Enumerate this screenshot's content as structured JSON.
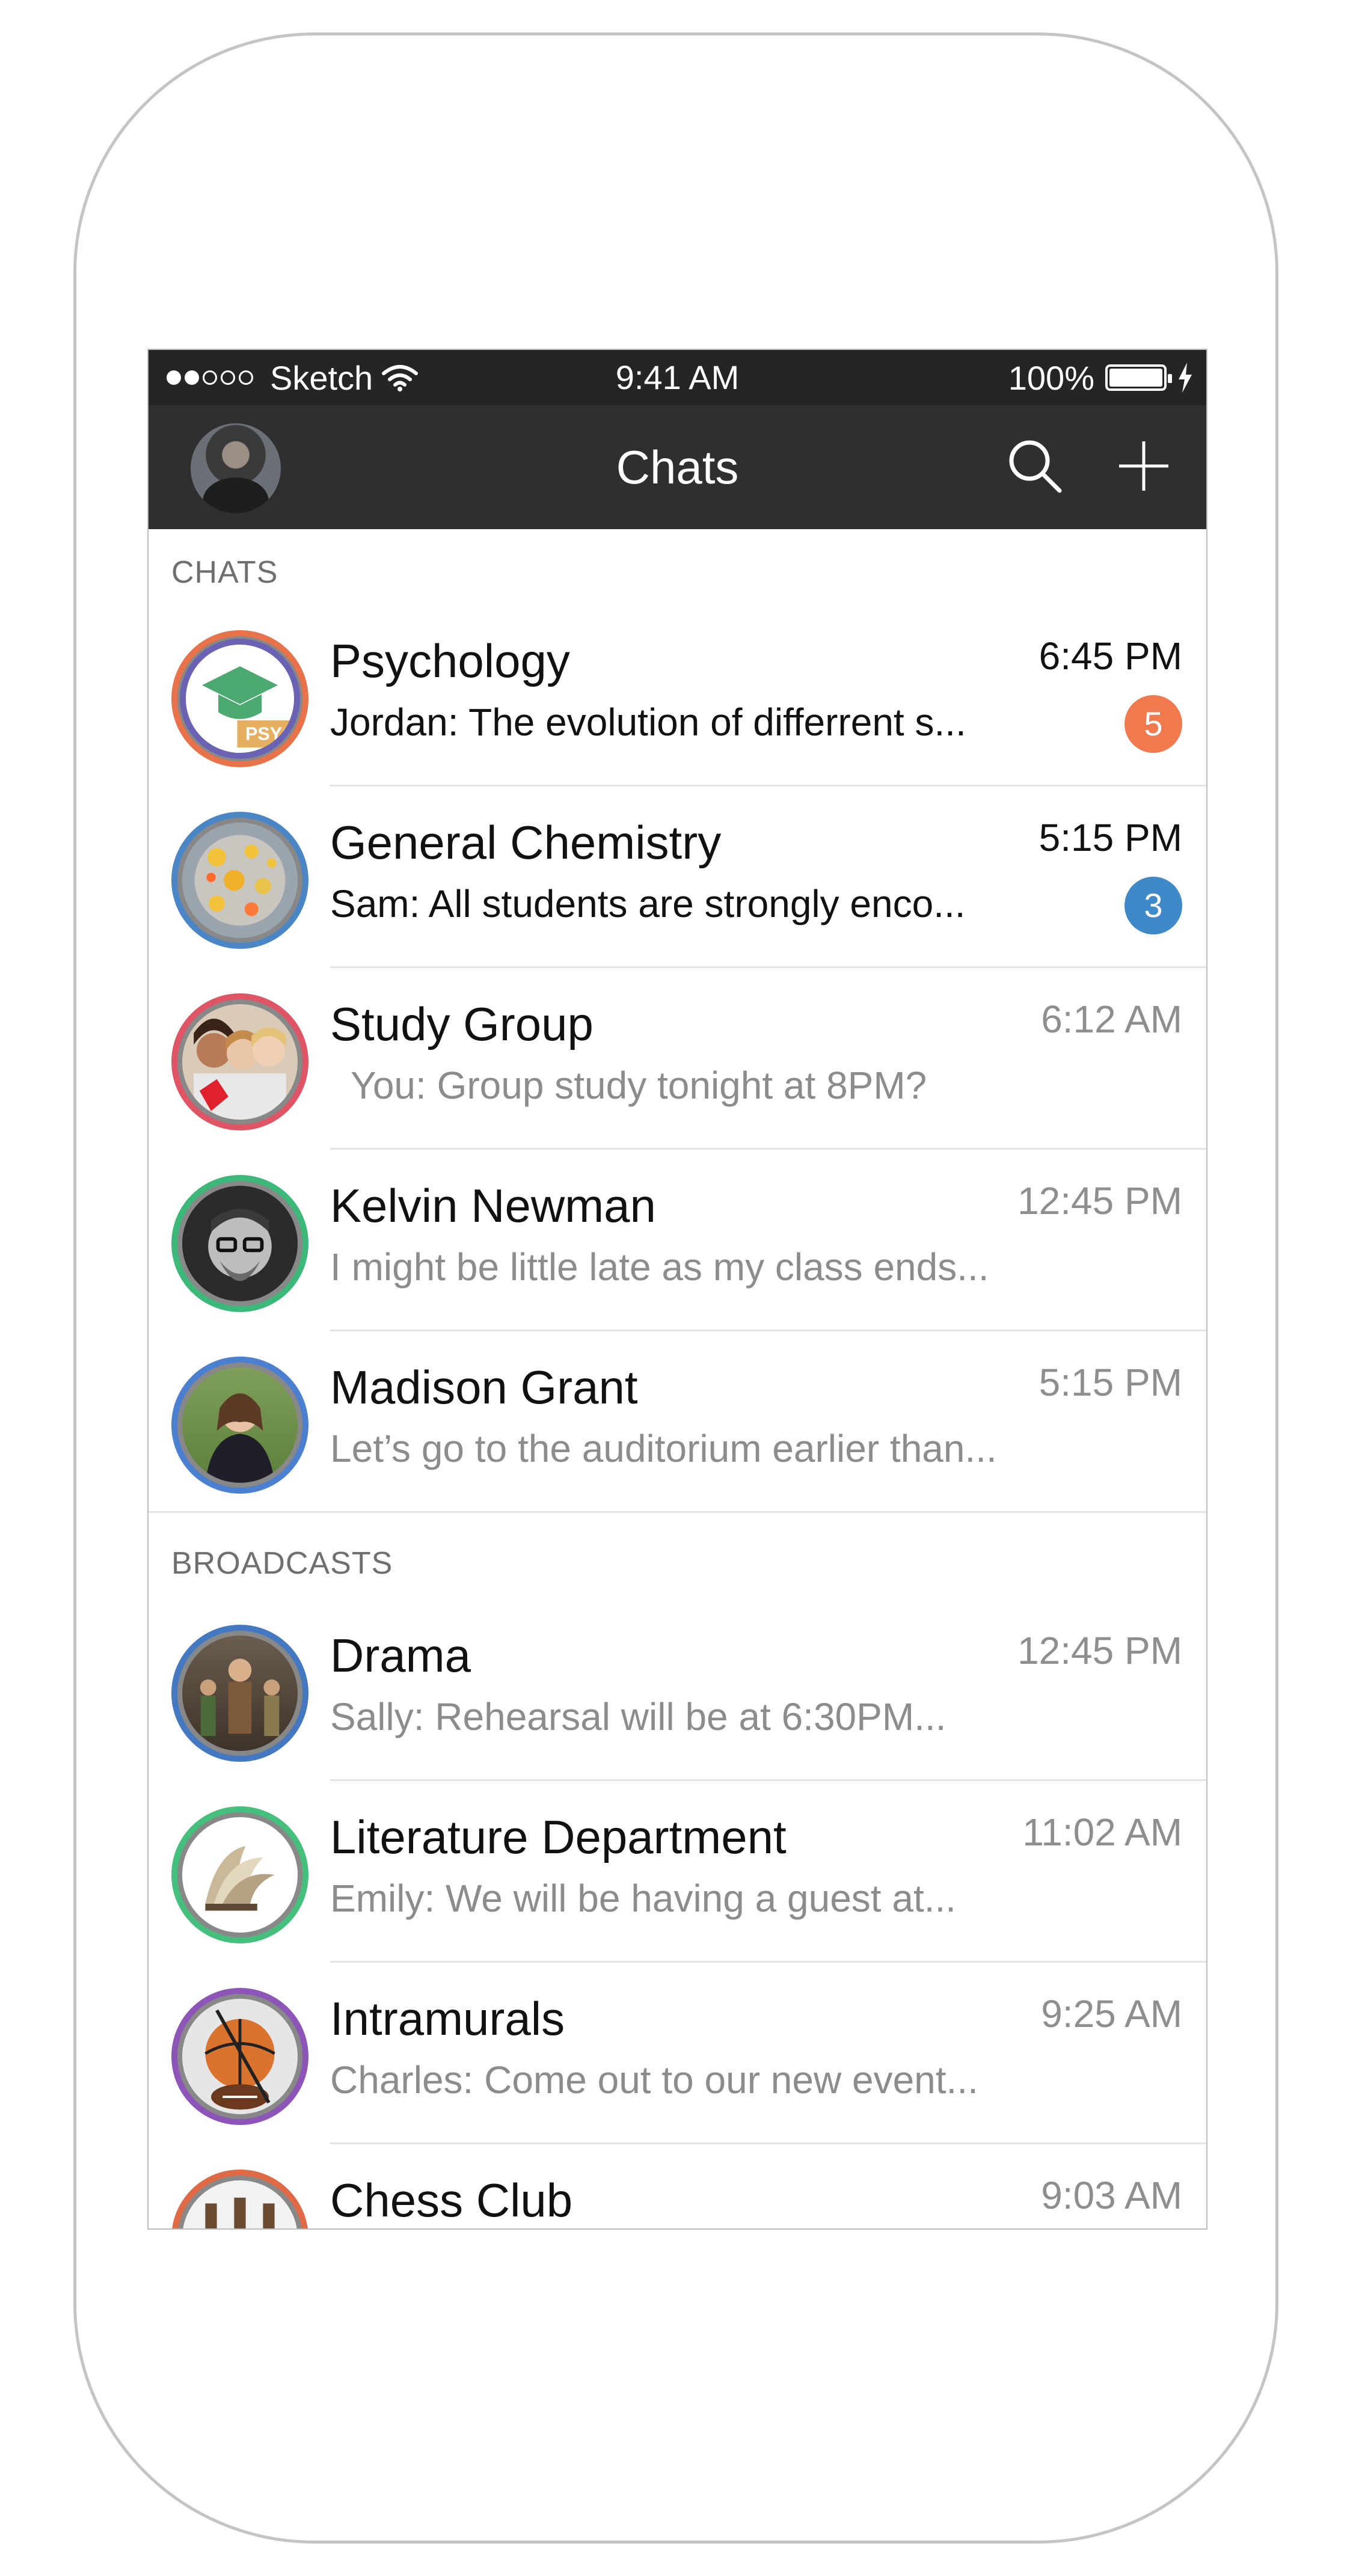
{
  "status_bar": {
    "carrier": "Sketch",
    "time": "9:41 AM",
    "battery": "100%"
  },
  "nav": {
    "title": "Chats"
  },
  "sections": {
    "chats_label": "CHATS",
    "broadcasts_label": "BROADCASTS"
  },
  "chats": [
    {
      "name": "Psychology",
      "time": "6:45 PM",
      "preview": "Jordan: The evolution of differrent s...",
      "badge": "5",
      "badge_color": "#f07a4e",
      "ring_color": "#e8724a",
      "unread": true
    },
    {
      "name": "General Chemistry",
      "time": "5:15 PM",
      "preview": "Sam: All students are strongly enco...",
      "badge": "3",
      "badge_color": "#3f89c8",
      "ring_color": "#4a86c5",
      "unread": true
    },
    {
      "name": "Study Group",
      "time": "6:12 AM",
      "preview": "You: Group study tonight at 8PM?",
      "ring_color": "#e05565",
      "unread": false
    },
    {
      "name": "Kelvin Newman",
      "time": "12:45 PM",
      "preview": "I might be little late as my class ends...",
      "ring_color": "#3cb878",
      "unread": false
    },
    {
      "name": "Madison Grant",
      "time": "5:15 PM",
      "preview": "Let’s go to the auditorium earlier than...",
      "ring_color": "#4b7fd0",
      "unread": false
    }
  ],
  "broadcasts": [
    {
      "name": "Drama",
      "time": "12:45 PM",
      "preview": "Sally: Rehearsal will be at 6:30PM...",
      "ring_color": "#4478c0"
    },
    {
      "name": "Literature Department",
      "time": "11:02 AM",
      "preview": "Emily: We will be having a guest at...",
      "ring_color": "#45c07c"
    },
    {
      "name": "Intramurals",
      "time": "9:25 AM",
      "preview": "Charles: Come out to our new event...",
      "ring_color": "#8e55b8"
    },
    {
      "name": "Chess Club",
      "time": "9:03 AM",
      "ring_color": "#e06a45"
    }
  ]
}
